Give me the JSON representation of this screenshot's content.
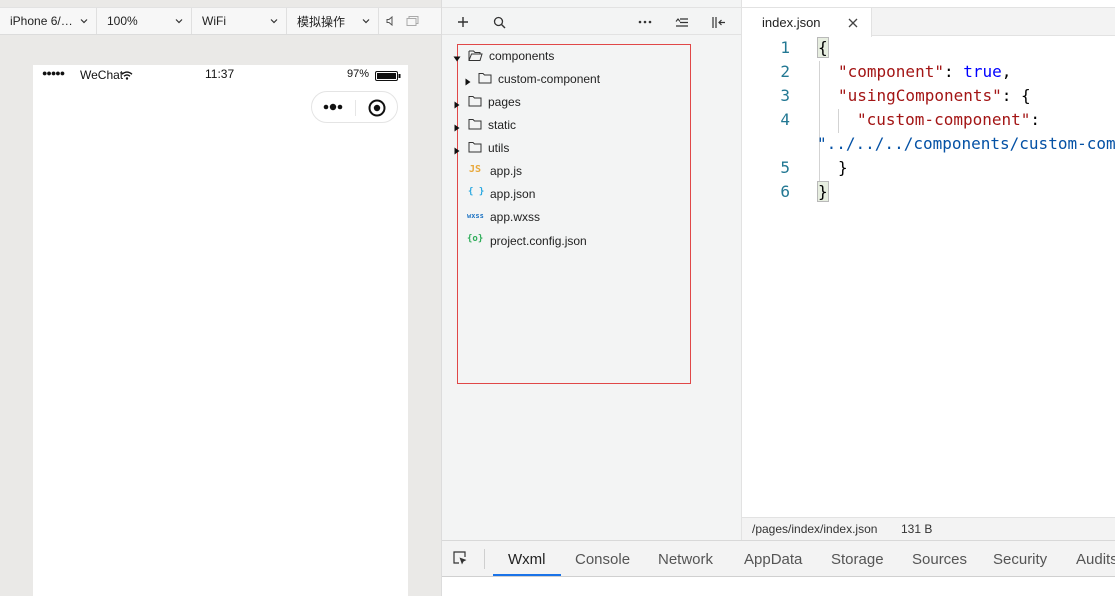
{
  "simulator": {
    "toolbar": {
      "device": "iPhone 6/…",
      "zoom": "100%",
      "network": "WiFi",
      "simulate": "模拟操作"
    },
    "status_bar": {
      "signal": "●●●●●",
      "carrier": "WeChat",
      "time": "11:37",
      "battery": "97%"
    },
    "capsule_icons": [
      "more-dots-icon",
      "close-circle-icon"
    ]
  },
  "explorer": {
    "toolbar_icons": [
      "plus-icon",
      "search-icon",
      "more-icon",
      "sort-icon",
      "collapse-panel-icon"
    ],
    "tree": [
      {
        "label": "components",
        "type": "folder",
        "expanded": true,
        "depth": 0
      },
      {
        "label": "custom-component",
        "type": "folder",
        "expanded": false,
        "depth": 1
      },
      {
        "label": "pages",
        "type": "folder",
        "expanded": false,
        "depth": 0
      },
      {
        "label": "static",
        "type": "folder",
        "expanded": false,
        "depth": 0
      },
      {
        "label": "utils",
        "type": "folder",
        "expanded": false,
        "depth": 0
      },
      {
        "label": "app.js",
        "type": "js",
        "glyph": "JS",
        "color": "#e8a83b",
        "depth": 0
      },
      {
        "label": "app.json",
        "type": "json",
        "glyph": "{ }",
        "color": "#27a7e0",
        "depth": 0
      },
      {
        "label": "app.wxss",
        "type": "wxss",
        "glyph": "wxss",
        "color": "#2276c4",
        "depth": 0
      },
      {
        "label": "project.config.json",
        "type": "config",
        "glyph": "{o}",
        "color": "#2fad5a",
        "depth": 0
      }
    ],
    "selection_border_color": "#e04747"
  },
  "editor": {
    "tab": {
      "label": "index.json",
      "close": "✕"
    },
    "line_numbers": [
      "1",
      "2",
      "3",
      "4",
      "",
      "5",
      "6"
    ],
    "code": {
      "l1_open": "{",
      "l2_key": "\"component\"",
      "l2_colon": ": ",
      "l2_val": "true",
      "l2_comma": ",",
      "l3_key": "\"usingComponents\"",
      "l3_rest": ": {",
      "l4_key": "\"custom-component\"",
      "l4_colon": ":",
      "l4b_val": "\"../../../components/custom-component/custom-component\"",
      "l5_close": "}",
      "l6_close": "}"
    },
    "status": {
      "path": "/pages/index/index.json",
      "size": "131 B"
    }
  },
  "devtools": {
    "tabs": [
      "Wxml",
      "Console",
      "Network",
      "AppData",
      "Storage",
      "Sources",
      "Security",
      "Audits"
    ],
    "active_tab": "Wxml",
    "accent": "#1a73e8"
  }
}
